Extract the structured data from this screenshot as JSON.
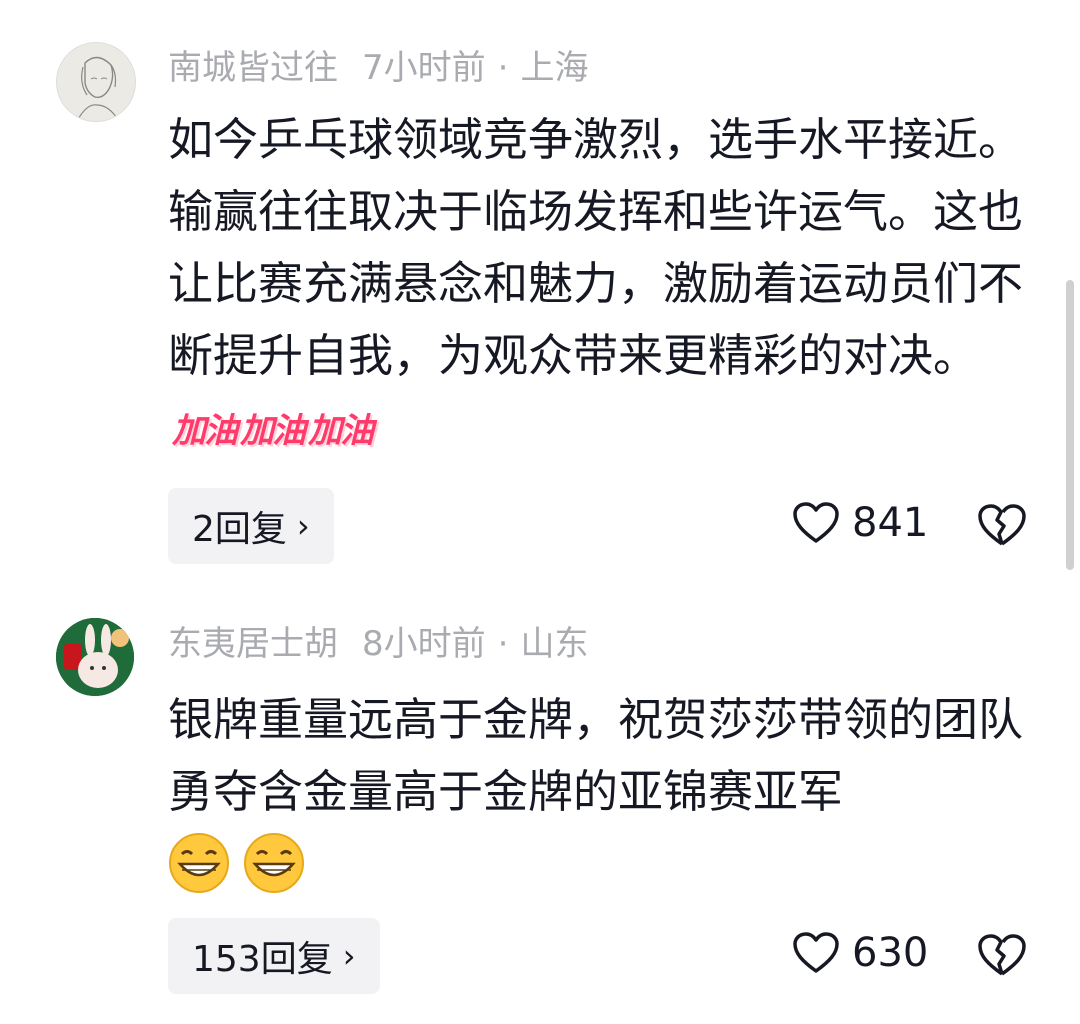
{
  "comments": [
    {
      "username": "南城皆过往",
      "time": "7小时前",
      "location": "上海",
      "text": "如今乒乓球领域竞争激烈，选手水平接近。输赢往往取决于临场发挥和些许运气。这也让比赛充满悬念和魅力，激励着运动员们不断提升自我，为观众带来更精彩的对决。",
      "stickers": [
        "加油",
        "加油",
        "加油"
      ],
      "reply_label": "2回复",
      "likes": "841"
    },
    {
      "username": "东夷居士胡",
      "time": "8小时前",
      "location": "山东",
      "text": "银牌重量远高于金牌，祝贺莎莎带领的团队勇夺含金量高于金牌的亚锦赛亚军",
      "emojis": [
        "grin-emoji",
        "grin-emoji"
      ],
      "reply_label": "153回复",
      "likes": "630"
    }
  ],
  "separator": "·",
  "chevron": "›",
  "colors": {
    "meta": "#a9abb0",
    "text": "#161823",
    "reply_bg": "#f2f2f4",
    "sticker": "#ff3b6b"
  }
}
